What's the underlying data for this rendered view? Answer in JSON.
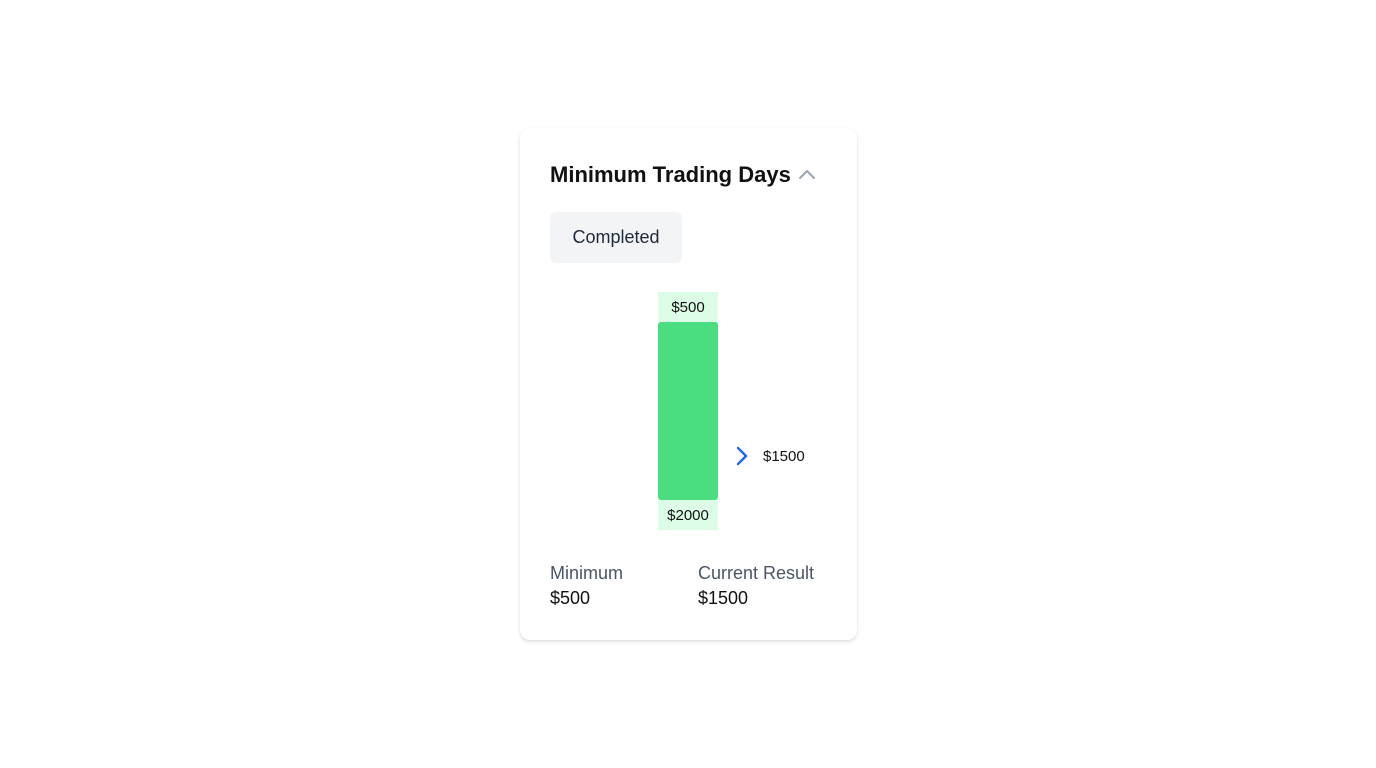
{
  "card": {
    "title": "Minimum Trading Days",
    "collapse_icon": "chevron-up-icon",
    "status_badge": "Completed"
  },
  "progress": {
    "top_label": "$500",
    "bottom_label": "$2000",
    "marker_icon": "chevron-right-icon",
    "marker_label": "$1500",
    "fill_color": "#4ade80",
    "track_color": "#dcfce7",
    "marker_color": "#2563eb"
  },
  "stats": {
    "minimum": {
      "label": "Minimum",
      "value": "$500"
    },
    "current": {
      "label": "Current Result",
      "value": "$1500"
    }
  }
}
